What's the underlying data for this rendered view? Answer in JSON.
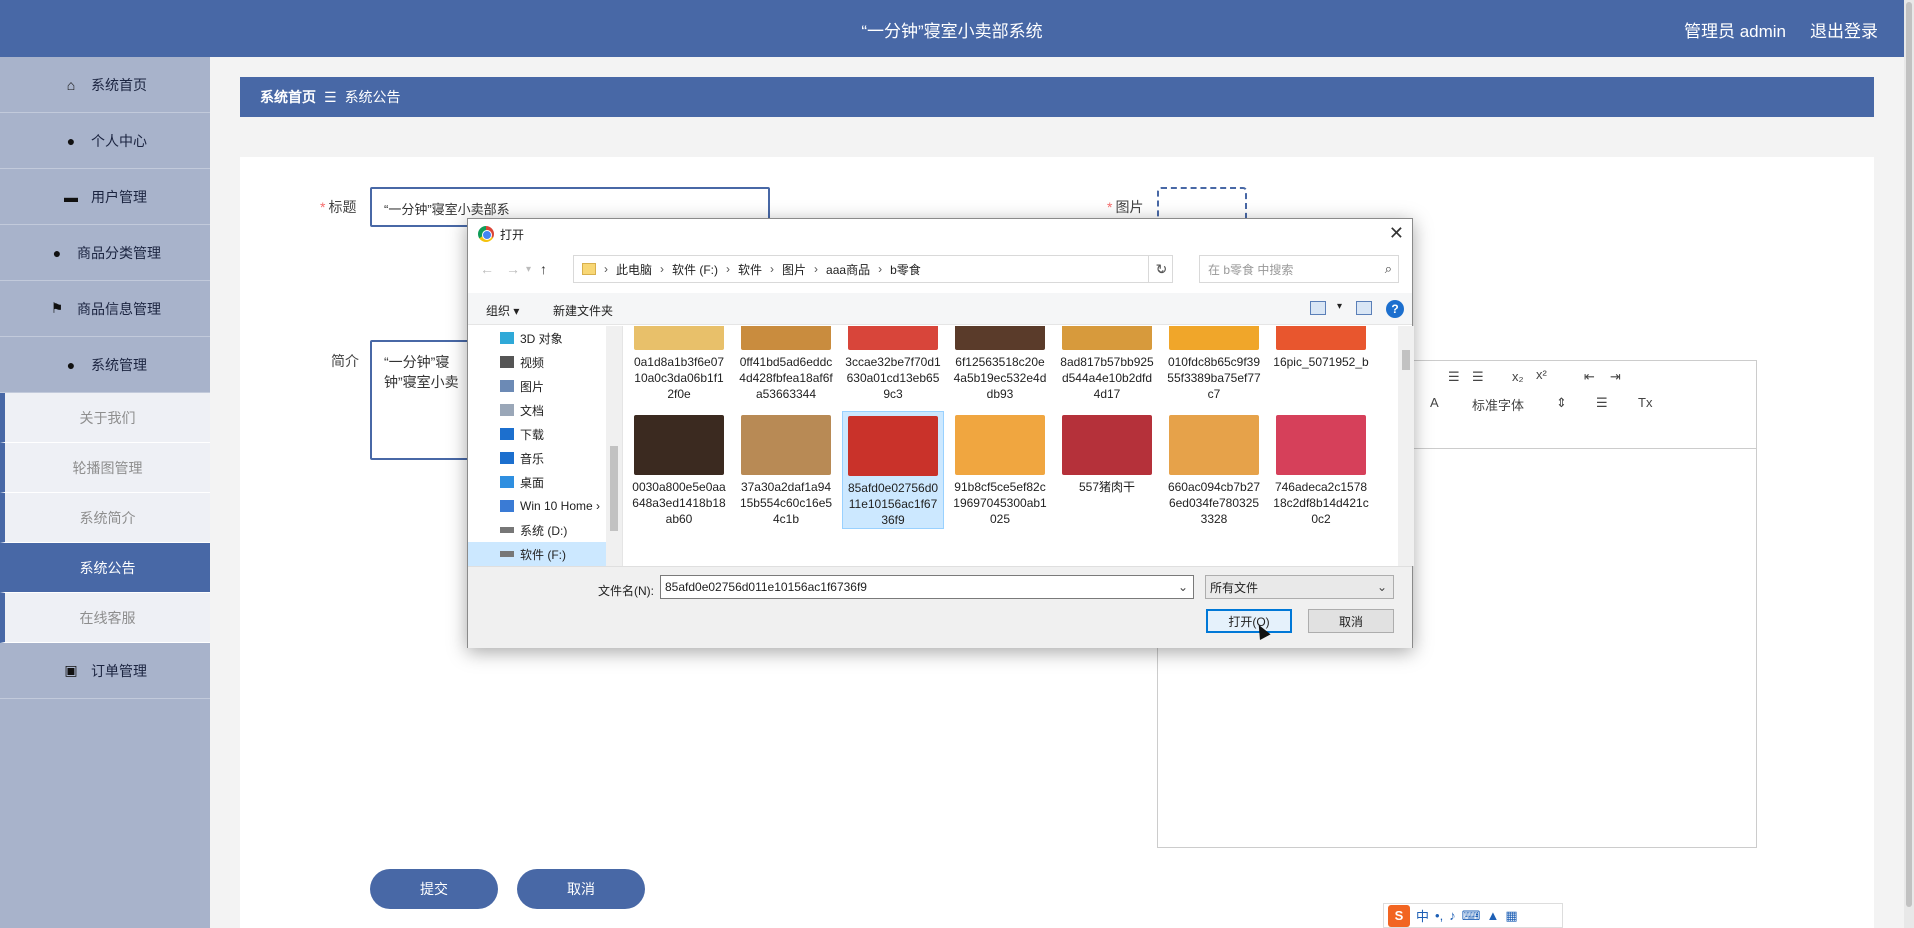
{
  "header": {
    "title": "“一分钟”寝室小卖部系统",
    "user": "管理员 admin",
    "logout": "退出登录"
  },
  "sidebar": {
    "items": [
      {
        "label": "系统首页",
        "icon": "home-icon"
      },
      {
        "label": "个人中心",
        "icon": "user-icon"
      },
      {
        "label": "用户管理",
        "icon": "user-manage-icon"
      },
      {
        "label": "商品分类管理",
        "icon": "user-icon"
      },
      {
        "label": "商品信息管理",
        "icon": "flag-icon"
      },
      {
        "label": "系统管理",
        "icon": "bulb-icon"
      }
    ],
    "sub_items": [
      {
        "label": "关于我们"
      },
      {
        "label": "轮播图管理"
      },
      {
        "label": "系统简介"
      },
      {
        "label": "系统公告"
      },
      {
        "label": "在线客服"
      }
    ],
    "last_item": {
      "label": "订单管理",
      "icon": "chart-icon"
    }
  },
  "breadcrumb": {
    "home": "系统首页",
    "current": "系统公告"
  },
  "form": {
    "title_label": "标题",
    "title_value": "“一分钟”寝室小卖部系",
    "image_label": "图片",
    "intro_label": "简介",
    "intro_value": "“一分钟”寝\n钟”寝室小卖",
    "editor_font": "标准字体",
    "submit": "提交",
    "cancel": "取消"
  },
  "ime": {
    "text": "中"
  },
  "dialog": {
    "title": "打开",
    "path": [
      "此电脑",
      "软件 (F:)",
      "软件",
      "图片",
      "aaa商品",
      "b零食"
    ],
    "search_placeholder": "在 b零食 中搜索",
    "organize": "组织 ▾",
    "new_folder": "新建文件夹",
    "tree": [
      {
        "label": "3D 对象",
        "icon": "3d-objects-icon",
        "color": "#2fa9d8"
      },
      {
        "label": "视频",
        "icon": "video-icon",
        "color": "#555555"
      },
      {
        "label": "图片",
        "icon": "pictures-icon",
        "color": "#555555"
      },
      {
        "label": "文档",
        "icon": "documents-icon",
        "color": "#555555"
      },
      {
        "label": "下载",
        "icon": "downloads-icon",
        "color": "#1c6fce"
      },
      {
        "label": "音乐",
        "icon": "music-icon",
        "color": "#1c6fce"
      },
      {
        "label": "桌面",
        "icon": "desktop-icon",
        "color": "#1c6fce"
      },
      {
        "label": "Win 10 Home ›",
        "icon": "drive-icon",
        "color": "#3a7bd5"
      },
      {
        "label": "系统 (D:)",
        "icon": "drive-icon",
        "color": "#666666"
      },
      {
        "label": "软件 (F:)",
        "icon": "drive-icon",
        "color": "#666666"
      }
    ],
    "files_row1": [
      {
        "name": "0a1d8a1b3f6e0710a0c3da06b1f12f0e",
        "color": "#e8c06a"
      },
      {
        "name": "0ff41bd5ad6eddc4d428fbfea18af6fa53663344",
        "color": "#c98c3e"
      },
      {
        "name": "3ccae32be7f70d1630a01cd13eb659c3",
        "color": "#d8453a"
      },
      {
        "name": "6f12563518c20e4a5b19ec532e4ddb93",
        "color": "#5a3b2a"
      },
      {
        "name": "8ad817b57bb925d544a4e10b2dfd4d17",
        "color": "#d79a3c"
      },
      {
        "name": "010fdc8b65c9f3955f3389ba75ef77c7",
        "color": "#f0a62a"
      },
      {
        "name": "16pic_5071952_b",
        "color": "#e8562e"
      }
    ],
    "files_row2": [
      {
        "name": "0030a800e5e0aa648a3ed1418b18ab60",
        "color": "#3b2a20"
      },
      {
        "name": "37a30a2daf1a9415b554c60c16e54c1b",
        "color": "#b88a55"
      },
      {
        "name": "85afd0e02756d011e10156ac1f6736f9",
        "color": "#c9322a"
      },
      {
        "name": "91b8cf5ce5ef82c19697045300ab1025",
        "color": "#f0a640"
      },
      {
        "name": "557猪肉干",
        "color": "#b5313a"
      },
      {
        "name": "660ac094cb7b276ed034fe7803253328",
        "color": "#e6a24a"
      },
      {
        "name": "746adeca2c157818c2df8b14d421c0c2",
        "color": "#d6405a"
      }
    ],
    "filename_label": "文件名(N):",
    "filename_value": "85afd0e02756d011e10156ac1f6736f9",
    "filetype": "所有文件",
    "open": "打开(O)",
    "cancel": "取消"
  }
}
